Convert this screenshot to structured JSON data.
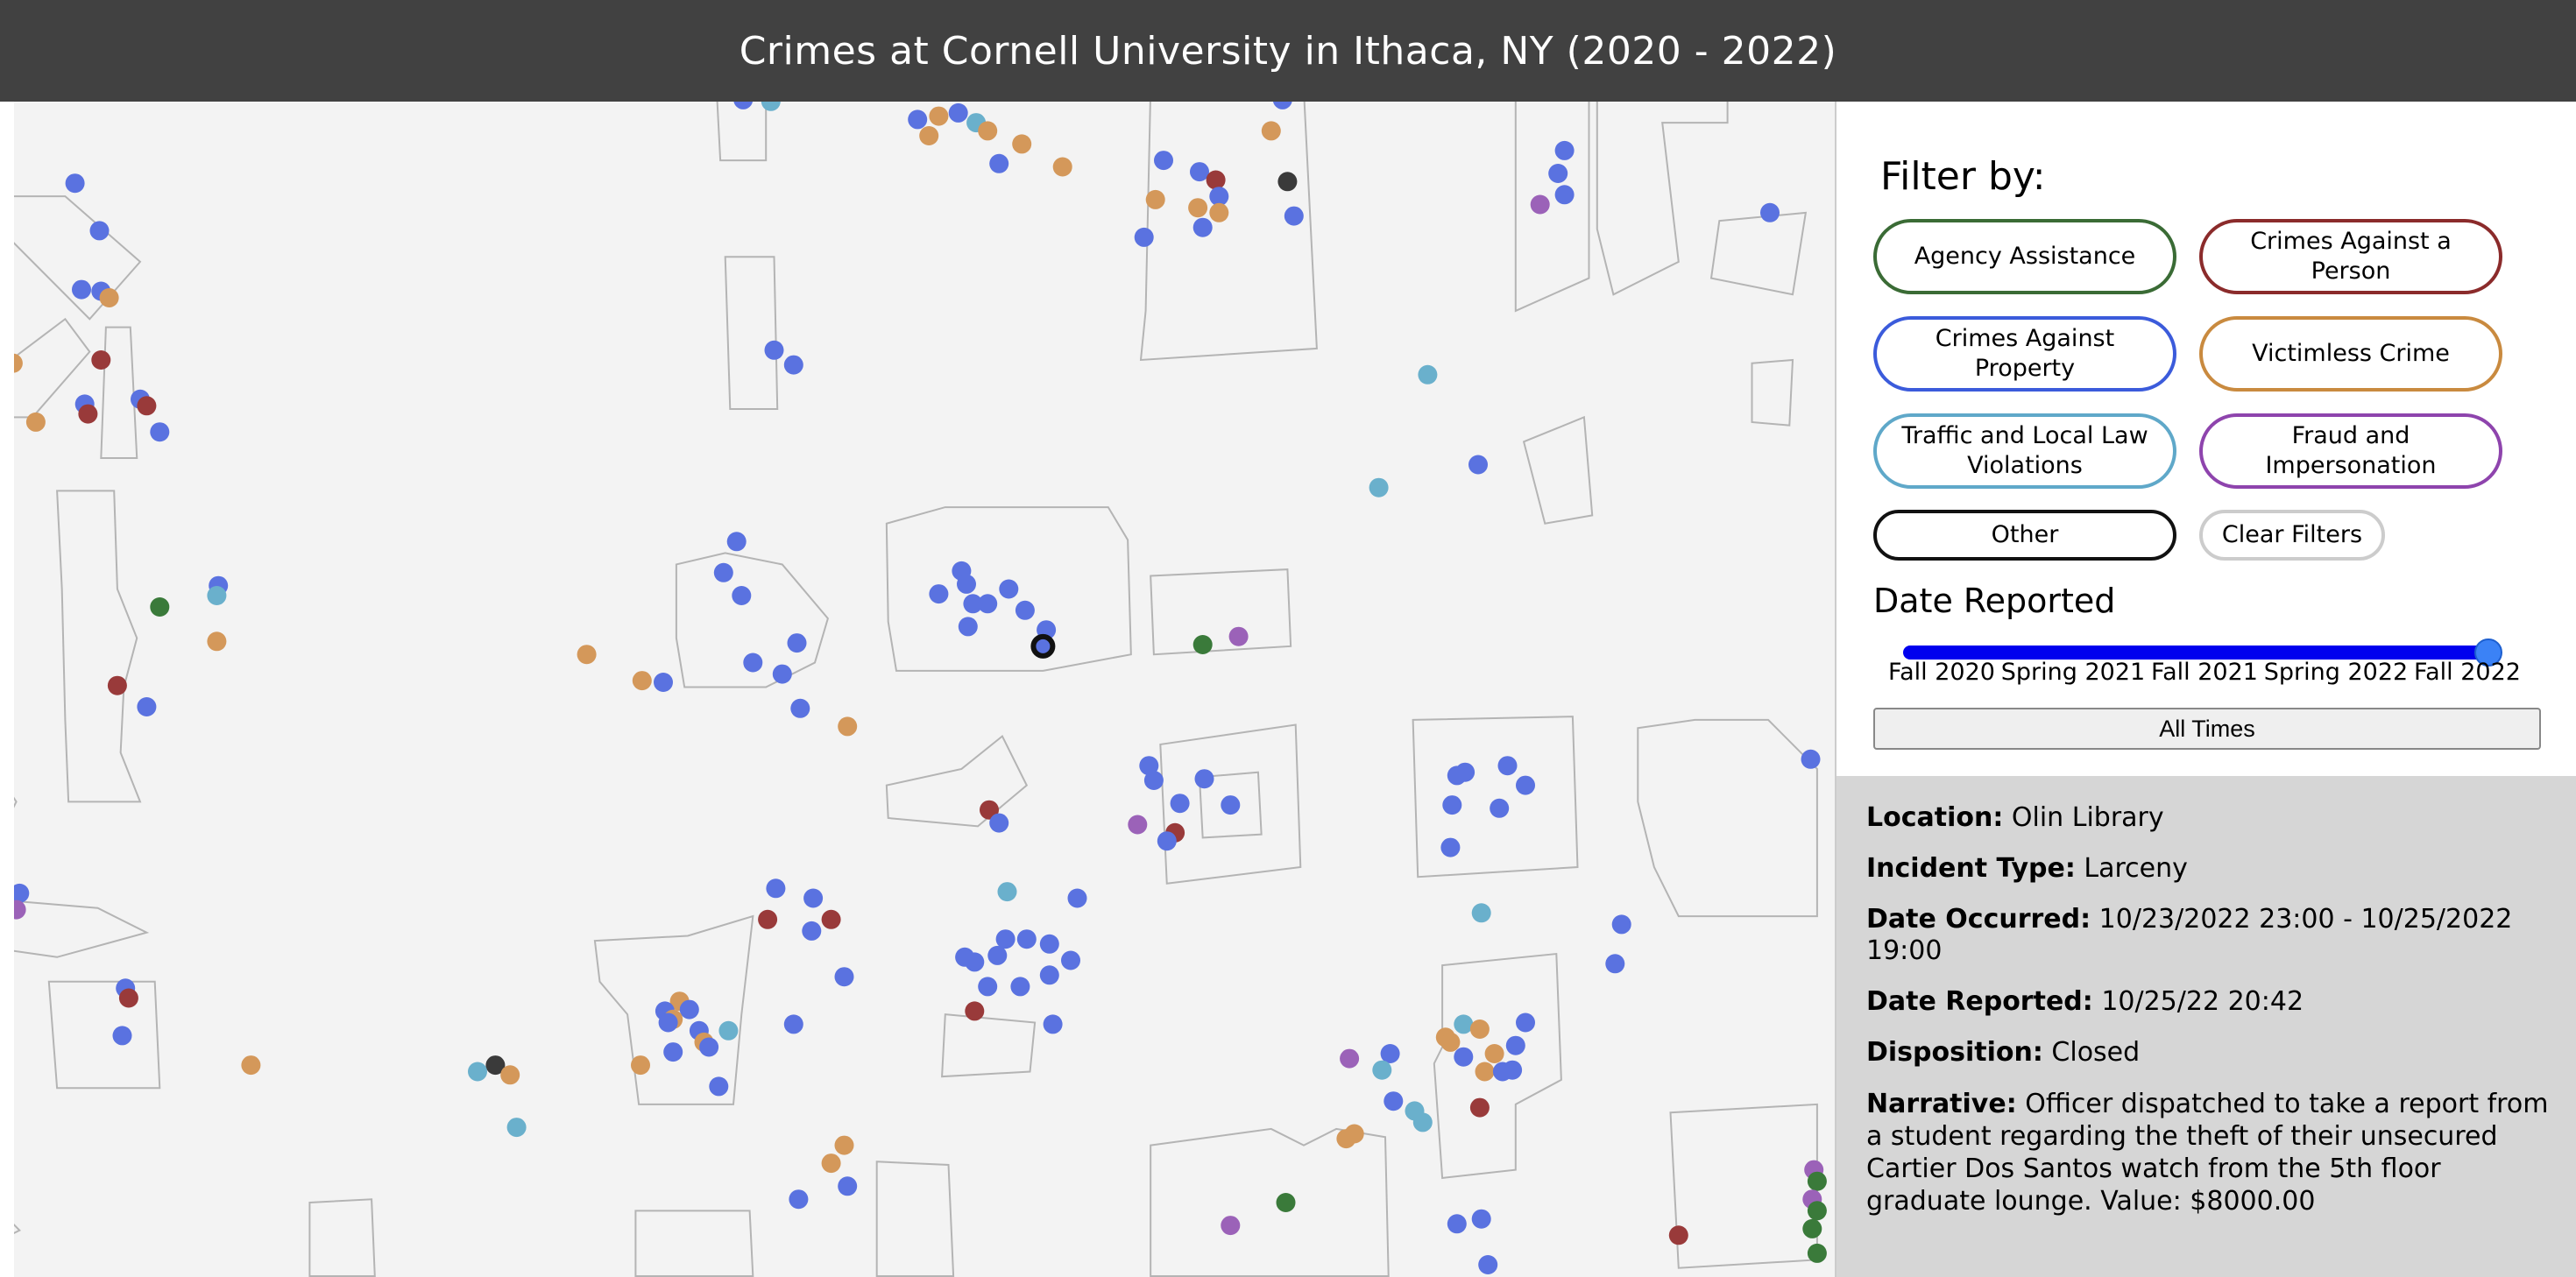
{
  "header": {
    "title": "Crimes at Cornell University in Ithaca, NY (2020 - 2022)"
  },
  "filters": {
    "title": "Filter by:",
    "buttons": [
      {
        "label": "Agency Assistance",
        "color": "#3a6b35"
      },
      {
        "label": "Crimes Against a Person",
        "color": "#8b2b2b"
      },
      {
        "label": "Crimes Against Property",
        "color": "#3b5bdb"
      },
      {
        "label": "Victimless Crime",
        "color": "#c98a3f"
      },
      {
        "label": "Traffic and Local Law Violations",
        "color": "#5fa8c9"
      },
      {
        "label": "Fraud and Impersonation",
        "color": "#8e44ad"
      },
      {
        "label": "Other",
        "color": "#111111"
      },
      {
        "label": "Clear Filters",
        "color": "#cccccc"
      }
    ]
  },
  "date_filter": {
    "title": "Date Reported",
    "ticks": [
      "Fall 2020",
      "Spring 2021",
      "Fall 2021",
      "Spring 2022",
      "Fall 2022"
    ],
    "selected": "Fall 2022",
    "all_times_label": "All Times"
  },
  "details": {
    "location_label": "Location:",
    "location": "Olin Library",
    "incident_label": "Incident Type:",
    "incident": "Larceny",
    "occurred_label": "Date Occurred:",
    "occurred": "10/23/2022 23:00 - 10/25/2022 19:00",
    "reported_label": "Date Reported:",
    "reported": "10/25/22 20:42",
    "disposition_label": "Disposition:",
    "disposition": "Closed",
    "narrative_label": "Narrative:",
    "narrative": "Officer dispatched to take a report from a student regarding the theft of their unsecured Cartier Dos Santos watch from the 5th floor graduate lounge. Value: $8000.00"
  },
  "colors": {
    "agency": "#3a7a3a",
    "person": "#993a3a",
    "property": "#5a72e0",
    "victimless": "#d4985a",
    "traffic": "#6ab0cc",
    "fraud": "#9b62b8",
    "other": "#3a3a3a",
    "selected_ring": "#111111"
  }
}
